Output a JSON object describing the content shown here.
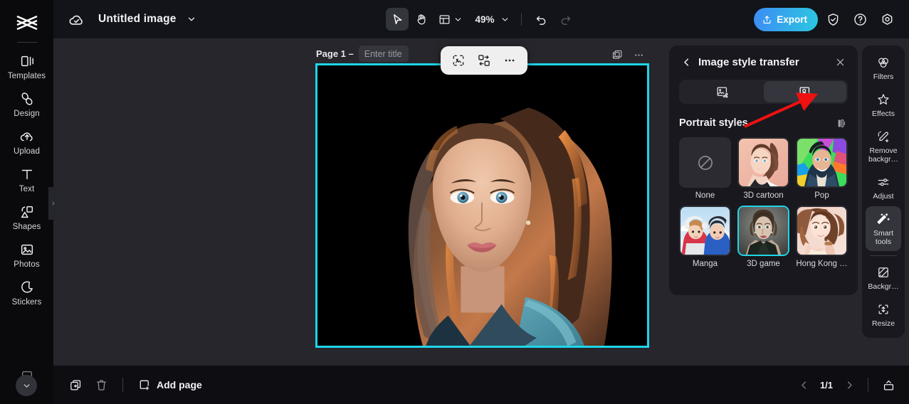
{
  "app": {
    "logo_icon": "capcut-logo-icon"
  },
  "left_rail": {
    "items": [
      {
        "label": "Templates",
        "icon": "templates-icon"
      },
      {
        "label": "Design",
        "icon": "design-icon"
      },
      {
        "label": "Upload",
        "icon": "upload-cloud-icon"
      },
      {
        "label": "Text",
        "icon": "text-icon"
      },
      {
        "label": "Shapes",
        "icon": "shapes-icon"
      },
      {
        "label": "Photos",
        "icon": "photos-icon"
      },
      {
        "label": "Stickers",
        "icon": "stickers-icon"
      }
    ],
    "collapse_icon": "chevron-down-icon",
    "expand_handle_icon": "chevron-right-icon"
  },
  "topbar": {
    "cloud_icon": "cloud-saved-icon",
    "document_title": "Untitled image",
    "title_dropdown_icon": "chevron-down-icon",
    "tools": [
      {
        "name": "select-tool",
        "icon": "cursor-arrow-icon",
        "active": true
      },
      {
        "name": "hand-tool",
        "icon": "hand-icon",
        "active": false
      },
      {
        "name": "layout-tool",
        "icon": "layout-grid-icon",
        "active": false
      }
    ],
    "layout_dropdown_icon": "chevron-down-icon",
    "zoom_level": "49%",
    "zoom_dropdown_icon": "chevron-down-icon",
    "undo_icon": "undo-icon",
    "redo_icon": "redo-icon",
    "export_label": "Export",
    "export_icon": "export-upload-icon",
    "export_color": "#2bc7e0",
    "shield_icon": "shield-check-icon",
    "help_icon": "question-circle-icon",
    "settings_icon": "gear-icon"
  },
  "canvas": {
    "page_label": "Page 1 –",
    "title_placeholder": "Enter title",
    "title_value": "",
    "duplicate_icon": "duplicate-image-icon",
    "more_icon": "more-horizontal-icon",
    "floating_toolbar": [
      {
        "name": "crop-select-icon"
      },
      {
        "name": "replace-image-icon"
      },
      {
        "name": "more-horizontal-icon"
      }
    ],
    "selection_color": "#1fd6e8"
  },
  "right_panel": {
    "back_icon": "chevron-left-icon",
    "title": "Image style transfer",
    "close_icon": "close-icon",
    "segments": [
      {
        "name": "scene-style-tab",
        "icon": "image-style-icon",
        "active": false
      },
      {
        "name": "portrait-style-tab",
        "icon": "portrait-style-icon",
        "active": true
      }
    ],
    "section_title": "Portrait styles",
    "compare_icon": "compare-split-icon",
    "styles": [
      {
        "label": "None",
        "selected": false,
        "kind": "none"
      },
      {
        "label": "3D cartoon",
        "selected": false,
        "kind": "cartoon3d"
      },
      {
        "label": "Pop",
        "selected": false,
        "kind": "pop"
      },
      {
        "label": "Manga",
        "selected": false,
        "kind": "manga"
      },
      {
        "label": "3D game",
        "selected": true,
        "kind": "game3d"
      },
      {
        "label": "Hong Kong …",
        "selected": false,
        "kind": "hongkong"
      }
    ],
    "annotation_arrow_color": "#ee1111"
  },
  "tool_rail": {
    "items": [
      {
        "label": "Filters",
        "icon": "filters-circles-icon",
        "active": false
      },
      {
        "label": "Effects",
        "icon": "effects-star-icon",
        "active": false
      },
      {
        "label": "Remove backgr…",
        "icon": "remove-background-icon",
        "active": false
      },
      {
        "label": "Adjust",
        "icon": "adjust-sliders-icon",
        "active": false
      },
      {
        "label": "Smart tools",
        "icon": "smart-tools-wand-icon",
        "active": true
      },
      {
        "label": "Backgr…",
        "icon": "background-icon",
        "active": false
      },
      {
        "label": "Resize",
        "icon": "resize-icon",
        "active": false
      }
    ]
  },
  "bottombar": {
    "duplicate_page_icon": "duplicate-page-icon",
    "delete_page_icon": "trash-icon",
    "add_page_label": "Add page",
    "add_page_icon": "add-page-icon",
    "prev_page_icon": "chevron-left-icon",
    "page_indicator": "1/1",
    "next_page_icon": "chevron-right-icon",
    "panel_toggle_icon": "bottom-panel-toggle-icon"
  }
}
